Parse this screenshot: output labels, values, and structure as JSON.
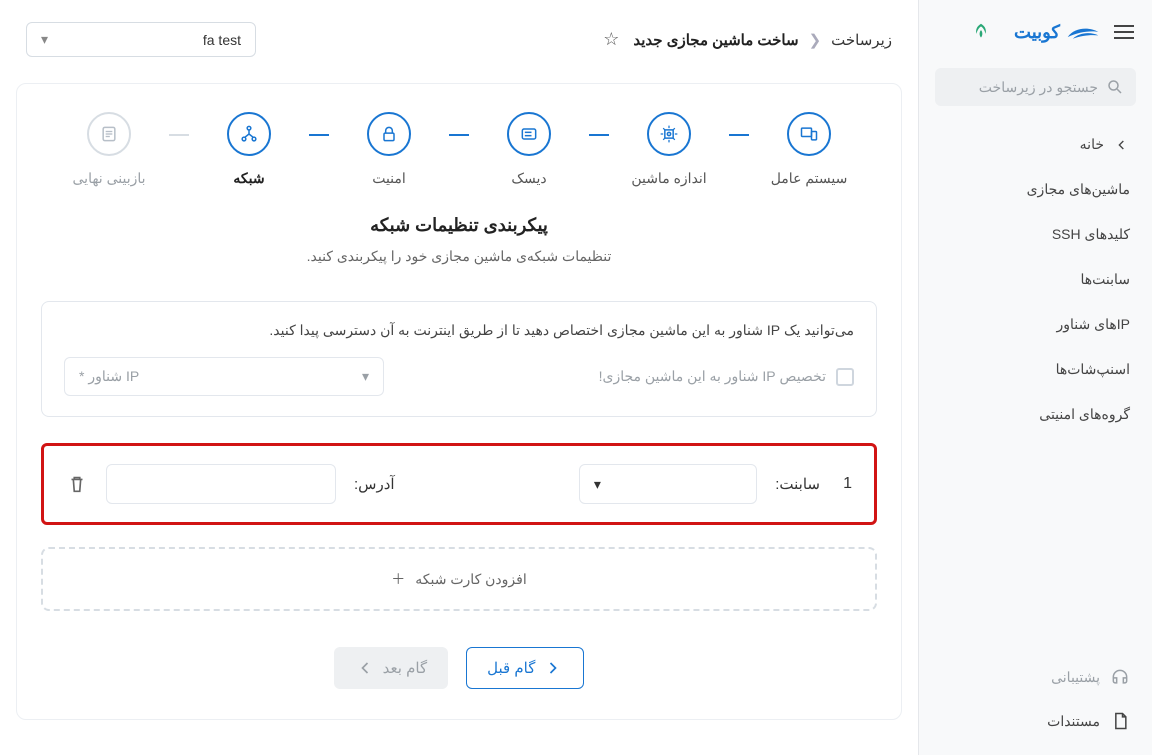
{
  "brand": "کوبیت",
  "search_placeholder": "جستجو در زیرساخت",
  "nav": {
    "home": "خانه",
    "items": [
      "ماشین‌های مجازی",
      "کلیدهای SSH",
      "سابنت‌ها",
      "IPهای شناور",
      "اسنپ‌شات‌ها",
      "گروه‌های امنیتی"
    ]
  },
  "footer": {
    "support": "پشتیبانی",
    "docs": "مستندات"
  },
  "breadcrumb": {
    "root": "زیرساخت",
    "current": "ساخت ماشین مجازی جدید"
  },
  "project": "fa test",
  "stepper": [
    {
      "label": "سیستم عامل",
      "icon": "devices"
    },
    {
      "label": "اندازه ماشین",
      "icon": "cpu"
    },
    {
      "label": "دیسک",
      "icon": "disk"
    },
    {
      "label": "امنیت",
      "icon": "lock"
    },
    {
      "label": "شبکه",
      "icon": "network",
      "current": true
    },
    {
      "label": "بازبینی نهایی",
      "icon": "list",
      "inactive": true
    }
  ],
  "section": {
    "title": "پیکربندی تنظیمات شبکه",
    "subtitle": "تنظیمات شبکه‌ی ماشین مجازی خود را پیکربندی کنید."
  },
  "floating_panel": {
    "text": "می‌توانید یک IP شناور به این ماشین مجازی اختصاص دهید تا از طریق اینترنت به آن دسترسی پیدا کنید.",
    "checkbox_label": "تخصیص IP شناور به این ماشین مجازی!",
    "select_label": "IP شناور *"
  },
  "nic": {
    "index": "1",
    "subnet_label": "سابنت:",
    "address_label": "آدرس:"
  },
  "add_nic": "افزودن کارت شبکه",
  "buttons": {
    "prev": "گام قبل",
    "next": "گام بعد"
  }
}
